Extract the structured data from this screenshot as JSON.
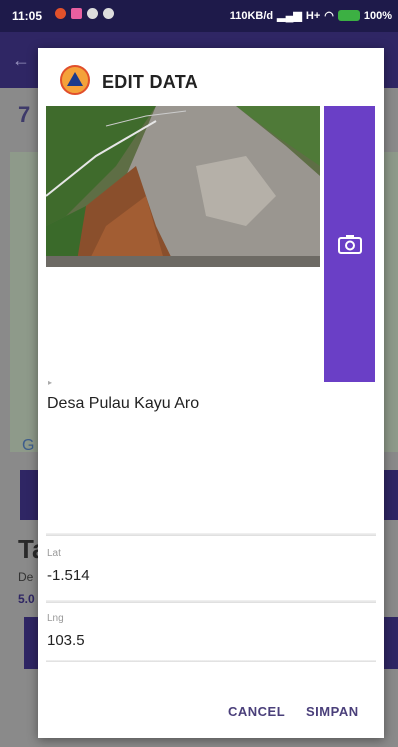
{
  "status_bar": {
    "time": "11:05",
    "network": "110KB/d",
    "carrier": "H+",
    "battery": "100%"
  },
  "background_app": {
    "number": "7",
    "letter_g": "G",
    "heading_fragment": "Ta",
    "desc_fragment": "De",
    "value_fragment": "5.0"
  },
  "dialog": {
    "title": "EDIT DATA",
    "camera_icon": "camera-icon",
    "description": "Desa Pulau Kayu Aro",
    "lat_label": "Lat",
    "lat_value": "-1.514",
    "lng_label": "Lng",
    "lng_value": "103.5",
    "cancel_label": "CANCEL",
    "save_label": "SIMPAN"
  },
  "colors": {
    "accent": "#6a3fc6",
    "toolbar": "#2f2664",
    "button_text": "#4a3f7a"
  }
}
